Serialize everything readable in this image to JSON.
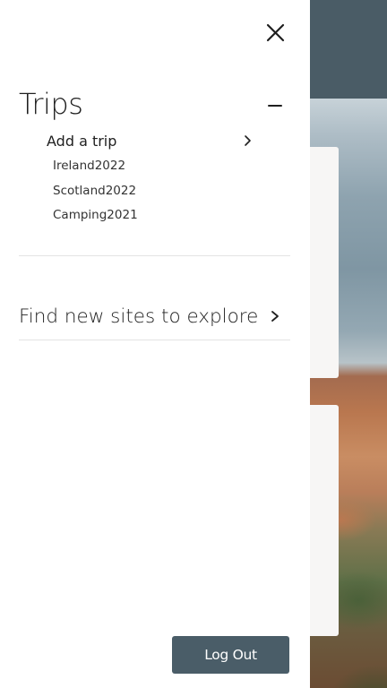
{
  "theme": {
    "header_color": "#4a5c66",
    "button_color": "#4a5d68",
    "text_color": "#1f1f1f",
    "divider_color": "#e3e3e3"
  },
  "drawer": {
    "close_icon": "close-icon",
    "trips": {
      "title": "Trips",
      "collapse_icon": "minus-icon",
      "add_trip": {
        "label": "Add a trip",
        "icon": "chevron-right-icon"
      },
      "items": [
        {
          "label": "Ireland2022"
        },
        {
          "label": "Scotland2022"
        },
        {
          "label": "Camping2021"
        }
      ]
    },
    "explore": {
      "label": "Find new sites to explore",
      "icon": "chevron-right-icon"
    },
    "logout_label": "Log Out"
  }
}
